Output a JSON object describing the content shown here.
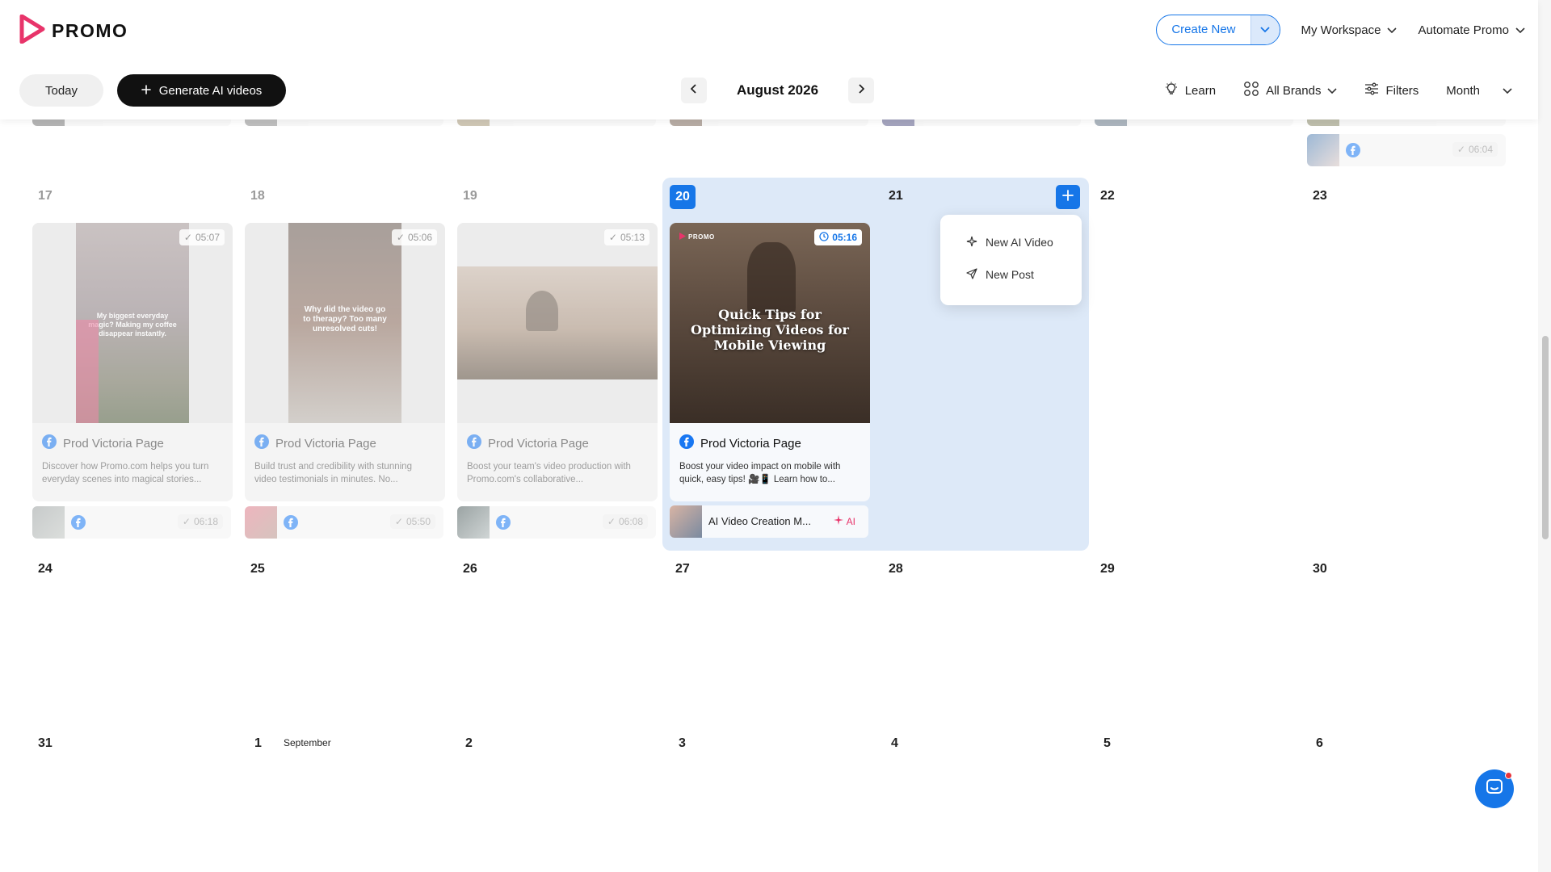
{
  "brand": {
    "name": "PROMO",
    "accent": "#1676e8",
    "logo_color": "#e8346a"
  },
  "header": {
    "create_new": "Create New",
    "workspace": "My Workspace",
    "automate": "Automate Promo",
    "today": "Today",
    "generate": "Generate AI videos",
    "month": "August 2026",
    "learn": "Learn",
    "brands": "All Brands",
    "filters": "Filters",
    "view": "Month"
  },
  "week_prev": {
    "last_time": "06:04"
  },
  "week3": {
    "days": [
      "17",
      "18",
      "19",
      "20",
      "21",
      "22",
      "23"
    ],
    "cards": [
      {
        "time": "05:07",
        "page": "Prod Victoria Page",
        "desc": "Discover how Promo.com helps you turn everyday scenes into magical stories...",
        "caption": "My biggest everyday magic? Making my coffee disappear instantly."
      },
      {
        "time": "05:06",
        "page": "Prod Victoria Page",
        "desc": "Build trust and credibility with stunning video testimonials in minutes. No...",
        "caption": "Why did the video go to therapy? Too many unresolved cuts!"
      },
      {
        "time": "05:13",
        "page": "Prod Victoria Page",
        "desc": "Boost your team's video production with Promo.com's collaborative...",
        "caption": ""
      },
      {
        "time": "05:16",
        "page": "Prod Victoria Page",
        "desc": "Boost your video impact on mobile with quick, easy tips! 🎥📱 Learn how to...",
        "caption": "Quick Tips for Optimizing Videos for Mobile Viewing",
        "brand": "PROMO"
      }
    ],
    "strips": [
      {
        "time": "06:18"
      },
      {
        "time": "05:50"
      },
      {
        "time": "06:08"
      }
    ],
    "ai_strip": {
      "label": "AI Video Creation M...",
      "badge": "AI"
    }
  },
  "popup": {
    "items": [
      "New AI Video",
      "New Post"
    ]
  },
  "week4": {
    "days": [
      "24",
      "25",
      "26",
      "27",
      "28",
      "29",
      "30"
    ]
  },
  "week5": {
    "days": [
      "31",
      "1",
      "2",
      "3",
      "4",
      "5",
      "6"
    ],
    "month_label": "September"
  }
}
